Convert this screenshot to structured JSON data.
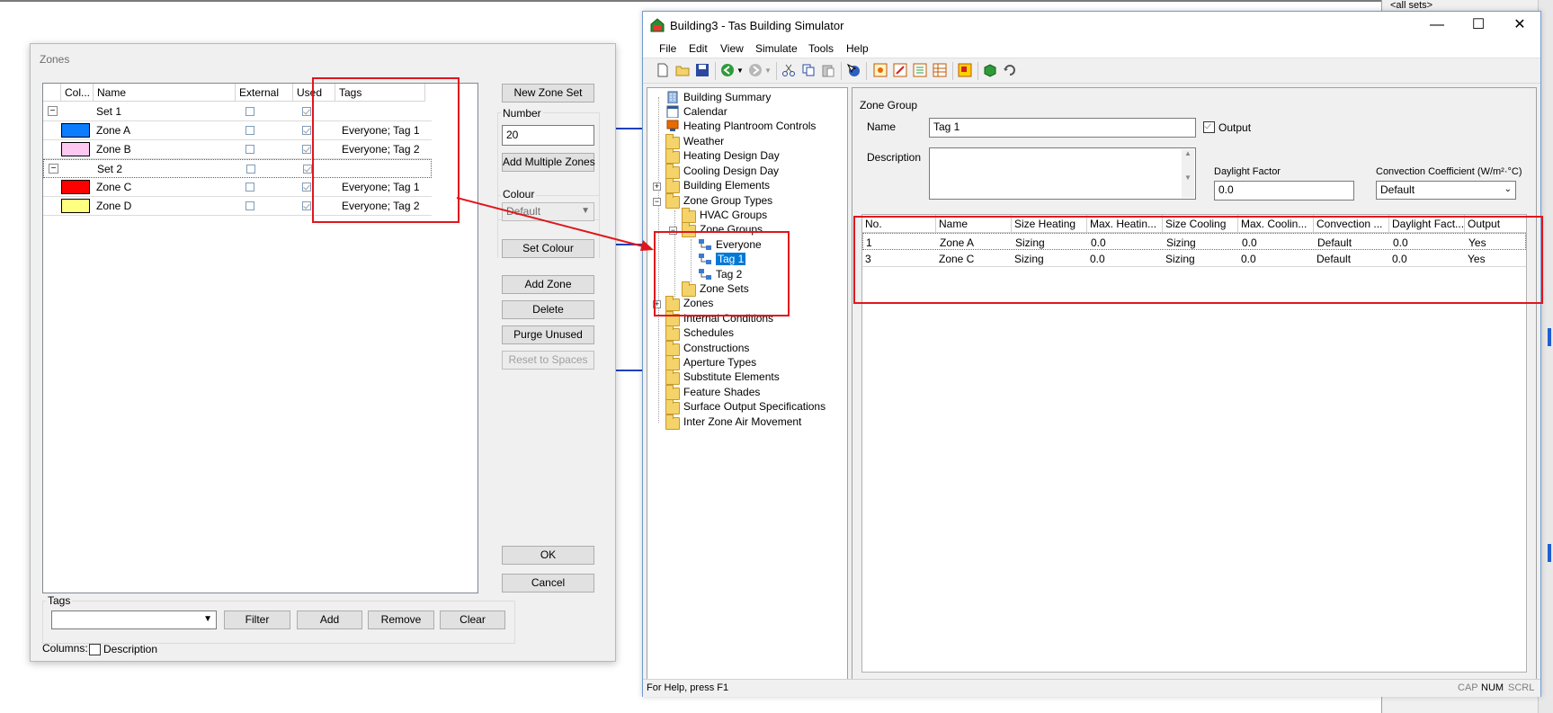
{
  "background": {
    "all_sets_label": "<all sets>"
  },
  "zones_dialog": {
    "title": "Zones",
    "columns": [
      "Col...",
      "Name",
      "External",
      "Used",
      "Tags"
    ],
    "rows": [
      {
        "kind": "set",
        "name": "Set 1",
        "external": false,
        "used": true,
        "tags": ""
      },
      {
        "kind": "zone",
        "color": "#0a7dff",
        "name": "Zone A",
        "external": false,
        "used": true,
        "tags": "Everyone; Tag 1"
      },
      {
        "kind": "zone",
        "color": "#ffc8f0",
        "name": "Zone B",
        "external": false,
        "used": true,
        "tags": "Everyone; Tag 2"
      },
      {
        "kind": "set",
        "name": "Set 2",
        "external": false,
        "used": true,
        "tags": ""
      },
      {
        "kind": "zone",
        "color": "#ff0000",
        "name": "Zone C",
        "external": false,
        "used": true,
        "tags": "Everyone; Tag 1"
      },
      {
        "kind": "zone",
        "color": "#ffff80",
        "name": "Zone D",
        "external": false,
        "used": true,
        "tags": "Everyone; Tag 2"
      }
    ],
    "expander": "−",
    "buttons": {
      "new_zone_set": "New Zone Set",
      "add_multiple_zones": "Add Multiple Zones",
      "set_colour": "Set Colour",
      "add_zone": "Add Zone",
      "delete": "Delete",
      "purge_unused": "Purge Unused",
      "reset_to_spaces": "Reset to Spaces",
      "ok": "OK",
      "cancel": "Cancel",
      "filter": "Filter",
      "add": "Add",
      "remove": "Remove",
      "clear": "Clear"
    },
    "number_label": "Number",
    "number_value": "20",
    "colour_label": "Colour",
    "colour_value": "Default",
    "tags_label": "Tags",
    "tags_value": "",
    "columns_label": "Columns:",
    "description_label": "Description"
  },
  "building_window": {
    "title": "Building3 - Tas Building Simulator",
    "window_controls": {
      "minimize": "—",
      "maximize": "☐",
      "close": "✕"
    },
    "menu": [
      "File",
      "Edit",
      "View",
      "Simulate",
      "Tools",
      "Help"
    ],
    "tree": {
      "building_summary": "Building Summary",
      "calendar": "Calendar",
      "heating_plantroom_controls": "Heating Plantroom Controls",
      "weather": "Weather",
      "heating_design_day": "Heating Design Day",
      "cooling_design_day": "Cooling Design Day",
      "building_elements": "Building Elements",
      "zone_group_types": "Zone Group Types",
      "hvac_groups": "HVAC Groups",
      "zone_groups": "Zone Groups",
      "everyone": "Everyone",
      "tag1": "Tag 1",
      "tag2": "Tag 2",
      "zone_sets": "Zone Sets",
      "zones": "Zones",
      "internal_conditions": "Internal Conditions",
      "schedules": "Schedules",
      "constructions": "Constructions",
      "aperture_types": "Aperture Types",
      "substitute_elements": "Substitute Elements",
      "feature_shades": "Feature Shades",
      "surface_output_specifications": "Surface Output Specifications",
      "inter_zone_air_movement": "Inter Zone Air Movement",
      "plus": "+",
      "minus": "−"
    },
    "panel": {
      "heading": "Zone Group",
      "name_label": "Name",
      "name_value": "Tag 1",
      "output_label": "Output",
      "output_checked": true,
      "description_label": "Description",
      "daylight_factor_label": "Daylight Factor",
      "daylight_factor_value": "0.0",
      "convection_label": "Convection Coefficient (W/m²·°C)",
      "convection_value": "Default",
      "table_columns": [
        "No.",
        "Name",
        "Size Heating",
        "Max. Heatin...",
        "Size Cooling",
        "Max. Coolin...",
        "Convection ...",
        "Daylight Fact...",
        "Output"
      ],
      "table_rows": [
        [
          "1",
          "Zone A",
          "Sizing",
          "0.0",
          "Sizing",
          "0.0",
          "Default",
          "0.0",
          "Yes"
        ],
        [
          "3",
          "Zone C",
          "Sizing",
          "0.0",
          "Sizing",
          "0.0",
          "Default",
          "0.0",
          "Yes"
        ]
      ]
    },
    "status": {
      "help": "For Help, press F1",
      "cap": "CAP",
      "num": "NUM",
      "scrl": "SCRL"
    }
  },
  "colors": {
    "annotation_red": "#e0161d",
    "selection_blue": "#0078d7"
  }
}
